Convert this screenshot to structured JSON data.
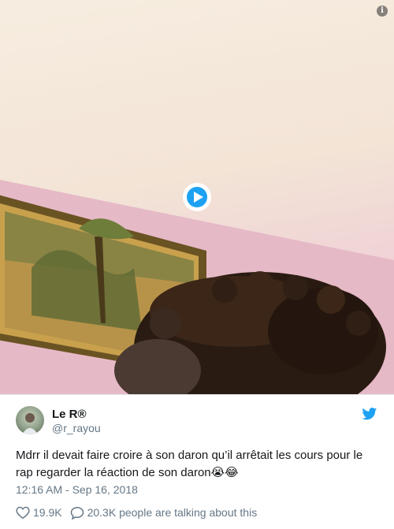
{
  "video": {
    "info_icon": "info-icon",
    "play_icon": "play-icon",
    "accent": "#1da1f2"
  },
  "tweet": {
    "display_name": "Le R®",
    "handle": "@r_rayou",
    "text": "Mdrr il devait faire croire à son daron qu’il arrêtait les cours pour le rap regarder la réaction de son daron😭😂",
    "timestamp": "12:16 AM - Sep 16, 2018",
    "likes": "19.9K",
    "talking": "20.3K people are talking about this",
    "brand_icon": "twitter-bird-icon",
    "brand_color": "#1da1f2"
  }
}
